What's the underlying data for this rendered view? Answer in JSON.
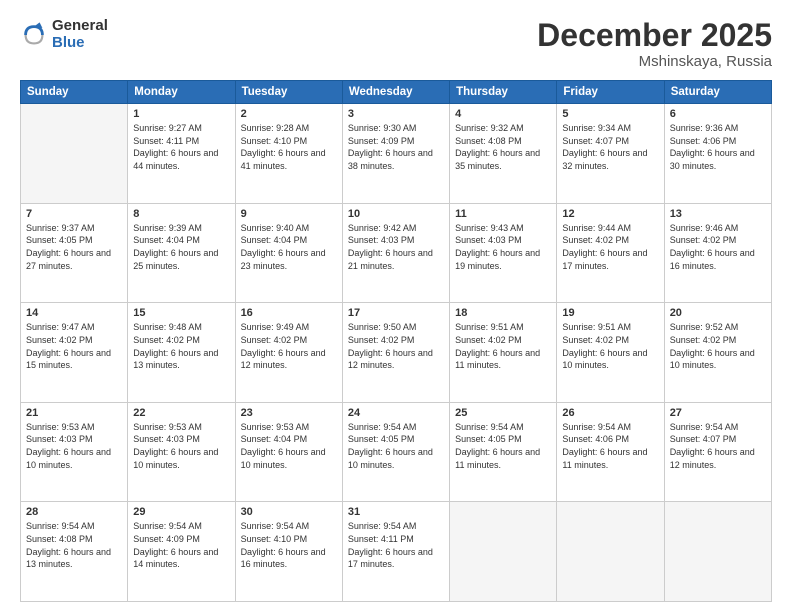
{
  "header": {
    "logo": {
      "general": "General",
      "blue": "Blue"
    },
    "month": "December 2025",
    "location": "Mshinskaya, Russia"
  },
  "weekdays": [
    "Sunday",
    "Monday",
    "Tuesday",
    "Wednesday",
    "Thursday",
    "Friday",
    "Saturday"
  ],
  "weeks": [
    [
      {
        "day": "",
        "empty": true
      },
      {
        "day": "1",
        "sunrise": "9:27 AM",
        "sunset": "4:11 PM",
        "daylight": "6 hours and 44 minutes."
      },
      {
        "day": "2",
        "sunrise": "9:28 AM",
        "sunset": "4:10 PM",
        "daylight": "6 hours and 41 minutes."
      },
      {
        "day": "3",
        "sunrise": "9:30 AM",
        "sunset": "4:09 PM",
        "daylight": "6 hours and 38 minutes."
      },
      {
        "day": "4",
        "sunrise": "9:32 AM",
        "sunset": "4:08 PM",
        "daylight": "6 hours and 35 minutes."
      },
      {
        "day": "5",
        "sunrise": "9:34 AM",
        "sunset": "4:07 PM",
        "daylight": "6 hours and 32 minutes."
      },
      {
        "day": "6",
        "sunrise": "9:36 AM",
        "sunset": "4:06 PM",
        "daylight": "6 hours and 30 minutes."
      }
    ],
    [
      {
        "day": "7",
        "sunrise": "9:37 AM",
        "sunset": "4:05 PM",
        "daylight": "6 hours and 27 minutes."
      },
      {
        "day": "8",
        "sunrise": "9:39 AM",
        "sunset": "4:04 PM",
        "daylight": "6 hours and 25 minutes."
      },
      {
        "day": "9",
        "sunrise": "9:40 AM",
        "sunset": "4:04 PM",
        "daylight": "6 hours and 23 minutes."
      },
      {
        "day": "10",
        "sunrise": "9:42 AM",
        "sunset": "4:03 PM",
        "daylight": "6 hours and 21 minutes."
      },
      {
        "day": "11",
        "sunrise": "9:43 AM",
        "sunset": "4:03 PM",
        "daylight": "6 hours and 19 minutes."
      },
      {
        "day": "12",
        "sunrise": "9:44 AM",
        "sunset": "4:02 PM",
        "daylight": "6 hours and 17 minutes."
      },
      {
        "day": "13",
        "sunrise": "9:46 AM",
        "sunset": "4:02 PM",
        "daylight": "6 hours and 16 minutes."
      }
    ],
    [
      {
        "day": "14",
        "sunrise": "9:47 AM",
        "sunset": "4:02 PM",
        "daylight": "6 hours and 15 minutes."
      },
      {
        "day": "15",
        "sunrise": "9:48 AM",
        "sunset": "4:02 PM",
        "daylight": "6 hours and 13 minutes."
      },
      {
        "day": "16",
        "sunrise": "9:49 AM",
        "sunset": "4:02 PM",
        "daylight": "6 hours and 12 minutes."
      },
      {
        "day": "17",
        "sunrise": "9:50 AM",
        "sunset": "4:02 PM",
        "daylight": "6 hours and 12 minutes."
      },
      {
        "day": "18",
        "sunrise": "9:51 AM",
        "sunset": "4:02 PM",
        "daylight": "6 hours and 11 minutes."
      },
      {
        "day": "19",
        "sunrise": "9:51 AM",
        "sunset": "4:02 PM",
        "daylight": "6 hours and 10 minutes."
      },
      {
        "day": "20",
        "sunrise": "9:52 AM",
        "sunset": "4:02 PM",
        "daylight": "6 hours and 10 minutes."
      }
    ],
    [
      {
        "day": "21",
        "sunrise": "9:53 AM",
        "sunset": "4:03 PM",
        "daylight": "6 hours and 10 minutes."
      },
      {
        "day": "22",
        "sunrise": "9:53 AM",
        "sunset": "4:03 PM",
        "daylight": "6 hours and 10 minutes."
      },
      {
        "day": "23",
        "sunrise": "9:53 AM",
        "sunset": "4:04 PM",
        "daylight": "6 hours and 10 minutes."
      },
      {
        "day": "24",
        "sunrise": "9:54 AM",
        "sunset": "4:05 PM",
        "daylight": "6 hours and 10 minutes."
      },
      {
        "day": "25",
        "sunrise": "9:54 AM",
        "sunset": "4:05 PM",
        "daylight": "6 hours and 11 minutes."
      },
      {
        "day": "26",
        "sunrise": "9:54 AM",
        "sunset": "4:06 PM",
        "daylight": "6 hours and 11 minutes."
      },
      {
        "day": "27",
        "sunrise": "9:54 AM",
        "sunset": "4:07 PM",
        "daylight": "6 hours and 12 minutes."
      }
    ],
    [
      {
        "day": "28",
        "sunrise": "9:54 AM",
        "sunset": "4:08 PM",
        "daylight": "6 hours and 13 minutes."
      },
      {
        "day": "29",
        "sunrise": "9:54 AM",
        "sunset": "4:09 PM",
        "daylight": "6 hours and 14 minutes."
      },
      {
        "day": "30",
        "sunrise": "9:54 AM",
        "sunset": "4:10 PM",
        "daylight": "6 hours and 16 minutes."
      },
      {
        "day": "31",
        "sunrise": "9:54 AM",
        "sunset": "4:11 PM",
        "daylight": "6 hours and 17 minutes."
      },
      {
        "day": "",
        "empty": true
      },
      {
        "day": "",
        "empty": true
      },
      {
        "day": "",
        "empty": true
      }
    ]
  ]
}
